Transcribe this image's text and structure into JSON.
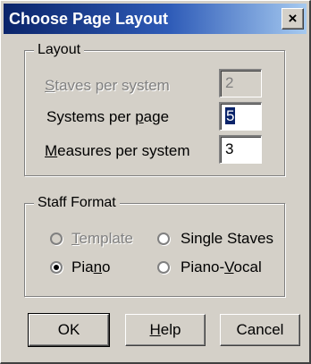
{
  "window": {
    "title": "Choose Page Layout",
    "close_glyph": "✕"
  },
  "layout_group": {
    "legend": "Layout",
    "staves_per_system": {
      "label": "Staves per system",
      "value": "2"
    },
    "systems_per_page": {
      "label": "Systems per page",
      "value": "5"
    },
    "measures_per_system": {
      "label": "Measures per system",
      "value": "3"
    }
  },
  "staff_format_group": {
    "legend": "Staff Format",
    "options": [
      {
        "label": "Template",
        "selected": false,
        "enabled": false
      },
      {
        "label": "Single Staves",
        "selected": false,
        "enabled": true
      },
      {
        "label": "Piano",
        "selected": true,
        "enabled": true
      },
      {
        "label": "Piano-Vocal",
        "selected": false,
        "enabled": true
      }
    ]
  },
  "buttons": {
    "ok": "OK",
    "help": "Help",
    "cancel": "Cancel"
  }
}
